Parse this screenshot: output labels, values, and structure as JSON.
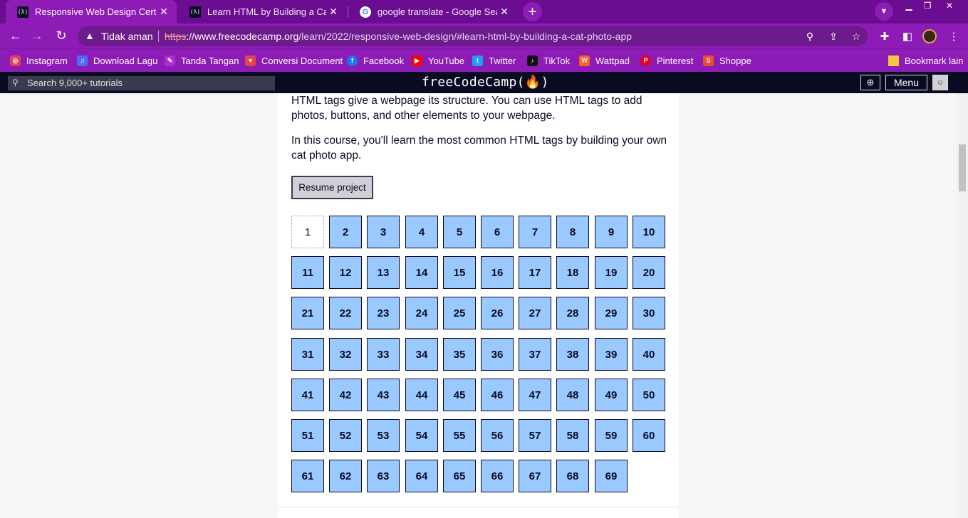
{
  "browser": {
    "tabs": [
      {
        "title": "Responsive Web Design Certifica",
        "active": true,
        "favicon": "fcc-favicon"
      },
      {
        "title": "Learn HTML by Building a Cat Ph",
        "active": false,
        "favicon": "fcc-favicon"
      },
      {
        "title": "google translate - Google Search",
        "active": false,
        "favicon": "google-favicon"
      }
    ],
    "close_glyph": "✕",
    "new_tab_glyph": "+",
    "security_warning": "Tidak aman",
    "url_scheme": "https",
    "url_host": "://www.freecodecamp.org",
    "url_path": "/learn/2022/responsive-web-design/#learn-html-by-building-a-cat-photo-app",
    "bookmarks": [
      {
        "label": "Instagram",
        "icon": "instagram-icon",
        "color": "#e4405f"
      },
      {
        "label": "Download Lagu",
        "icon": "download-icon",
        "color": "#4a6cf7"
      },
      {
        "label": "Tanda Tangan",
        "icon": "signature-icon",
        "color": "#b02bd6"
      },
      {
        "label": "Conversi Document",
        "icon": "document-icon",
        "color": "#e84545"
      },
      {
        "label": "Facebook",
        "icon": "facebook-icon",
        "color": "#1877f2"
      },
      {
        "label": "YouTube",
        "icon": "youtube-icon",
        "color": "#ff0000"
      },
      {
        "label": "Twitter",
        "icon": "twitter-icon",
        "color": "#1da1f2"
      },
      {
        "label": "TikTok",
        "icon": "tiktok-icon",
        "color": "#111111"
      },
      {
        "label": "Wattpad",
        "icon": "wattpad-icon",
        "color": "#ff6122"
      },
      {
        "label": "Pinterest",
        "icon": "pinterest-icon",
        "color": "#e60023"
      },
      {
        "label": "Shoppe",
        "icon": "shopee-icon",
        "color": "#ee4d2d"
      }
    ],
    "other_bookmarks": "Bookmark lain",
    "colors": {
      "tabstrip": "#6a0d90",
      "toolbar": "#8d1bb6"
    }
  },
  "fcc": {
    "search_placeholder": "Search 9,000+ tutorials",
    "logo": "freeCodeCamp(🔥)",
    "menu_label": "Menu",
    "colors": {
      "nav": "#0a0a23",
      "step_bg": "#99c9ff",
      "text": "#0a0a23"
    }
  },
  "content": {
    "intro": "HTML tags give a webpage its structure. You can use HTML tags to add photos, buttons, and other elements to your webpage.",
    "course_desc": "In this course, you'll learn the most common HTML tags by building your own cat photo app.",
    "resume_label": "Resume project",
    "current_step": 1,
    "steps": [
      "1",
      "2",
      "3",
      "4",
      "5",
      "6",
      "7",
      "8",
      "9",
      "10",
      "11",
      "12",
      "13",
      "14",
      "15",
      "16",
      "17",
      "18",
      "19",
      "20",
      "21",
      "22",
      "23",
      "24",
      "25",
      "26",
      "27",
      "28",
      "29",
      "30",
      "31",
      "32",
      "33",
      "34",
      "35",
      "36",
      "37",
      "38",
      "39",
      "40",
      "41",
      "42",
      "43",
      "44",
      "45",
      "46",
      "47",
      "48",
      "49",
      "50",
      "51",
      "52",
      "53",
      "54",
      "55",
      "56",
      "57",
      "58",
      "59",
      "60",
      "61",
      "62",
      "63",
      "64",
      "65",
      "66",
      "67",
      "68",
      "69"
    ]
  }
}
